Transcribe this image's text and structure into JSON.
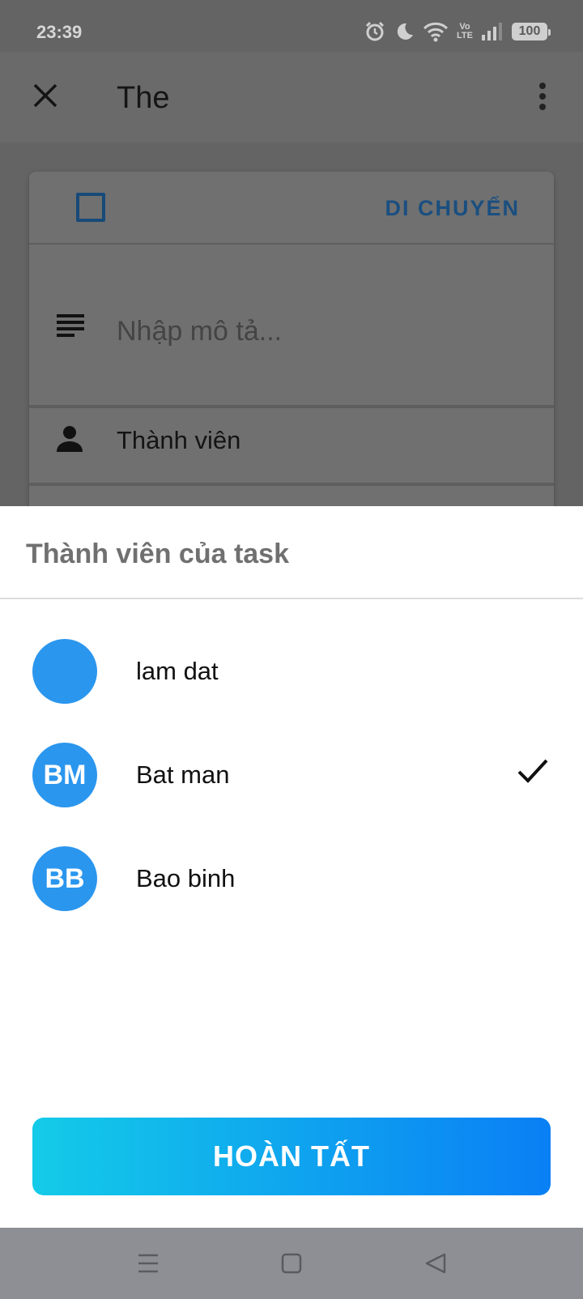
{
  "status_bar": {
    "time": "23:39",
    "volte_line1": "Vo",
    "volte_line2": "LTE",
    "battery": "100",
    "icons": [
      "alarm-icon",
      "moon-icon",
      "wifi-icon",
      "volte-icon",
      "signal-icon",
      "battery-icon"
    ]
  },
  "app_bar": {
    "title": "The",
    "close_icon": "close-icon",
    "more_icon": "more-vert-icon"
  },
  "card": {
    "move_label": "DI CHUYỂN",
    "description_placeholder": "Nhập mô tả...",
    "members_label": "Thành viên"
  },
  "sheet": {
    "title": "Thành viên của task",
    "members": [
      {
        "initials": "",
        "name": "lam dat",
        "selected": false
      },
      {
        "initials": "BM",
        "name": "Bat man",
        "selected": true
      },
      {
        "initials": "BB",
        "name": "Bao binh",
        "selected": false
      }
    ],
    "done_label": "HOÀN TẤT"
  },
  "colors": {
    "accent": "#2b96ee",
    "button_gradient_start": "#14cbe8",
    "button_gradient_end": "#0a7ff5",
    "scrim": "#646464"
  },
  "nav_bar": {
    "icons": [
      "menu-icon",
      "home-icon",
      "back-icon"
    ]
  }
}
